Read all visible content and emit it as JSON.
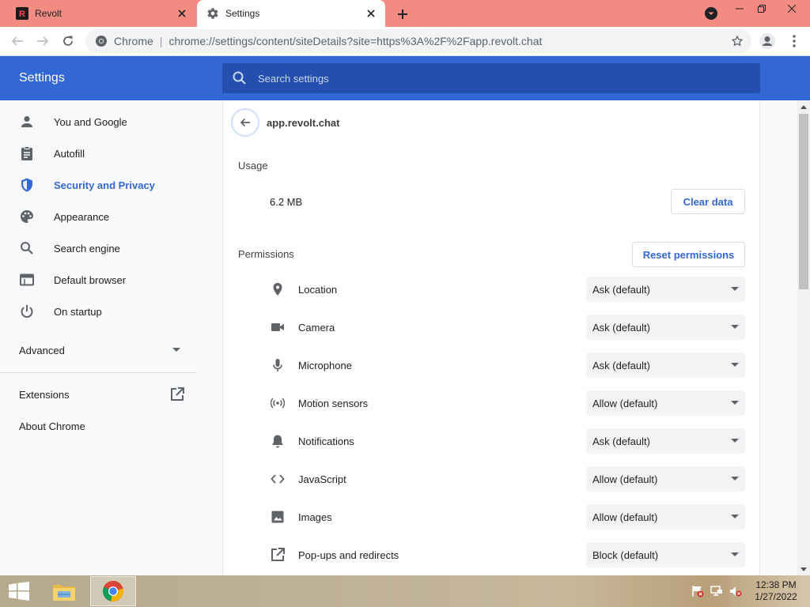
{
  "browser": {
    "tabs": [
      {
        "title": "Revolt",
        "active": false
      },
      {
        "title": "Settings",
        "active": true
      }
    ],
    "omnibox": {
      "scheme_label": "Chrome",
      "separator": "|",
      "url": "chrome://settings/content/siteDetails?site=https%3A%2F%2Fapp.revolt.chat"
    },
    "theme_color": "#f28b82"
  },
  "settings": {
    "title": "Settings",
    "search_placeholder": "Search settings",
    "accent_color": "#3367d6"
  },
  "sidebar": {
    "items": [
      {
        "label": "You and Google",
        "icon": "person-icon",
        "active": false
      },
      {
        "label": "Autofill",
        "icon": "clipboard-icon",
        "active": false
      },
      {
        "label": "Security and Privacy",
        "icon": "shield-icon",
        "active": true
      },
      {
        "label": "Appearance",
        "icon": "palette-icon",
        "active": false
      },
      {
        "label": "Search engine",
        "icon": "search-icon",
        "active": false
      },
      {
        "label": "Default browser",
        "icon": "browser-window-icon",
        "active": false
      },
      {
        "label": "On startup",
        "icon": "power-icon",
        "active": false
      }
    ],
    "advanced": "Advanced",
    "extensions": "Extensions",
    "about": "About Chrome"
  },
  "site": {
    "name": "app.revolt.chat",
    "usage_label": "Usage",
    "usage_value": "6.2 MB",
    "clear_data": "Clear data",
    "permissions_label": "Permissions",
    "reset_permissions": "Reset permissions",
    "permissions": [
      {
        "label": "Location",
        "value": "Ask (default)",
        "icon": "location-pin-icon"
      },
      {
        "label": "Camera",
        "value": "Ask (default)",
        "icon": "camera-icon"
      },
      {
        "label": "Microphone",
        "value": "Ask (default)",
        "icon": "microphone-icon"
      },
      {
        "label": "Motion sensors",
        "value": "Allow (default)",
        "icon": "sensors-icon"
      },
      {
        "label": "Notifications",
        "value": "Ask (default)",
        "icon": "bell-icon"
      },
      {
        "label": "JavaScript",
        "value": "Allow (default)",
        "icon": "code-icon"
      },
      {
        "label": "Images",
        "value": "Allow (default)",
        "icon": "image-icon"
      },
      {
        "label": "Pop-ups and redirects",
        "value": "Block (default)",
        "icon": "open-in-new-icon"
      }
    ]
  },
  "taskbar": {
    "time": "12:38 PM",
    "date": "1/27/2022"
  }
}
